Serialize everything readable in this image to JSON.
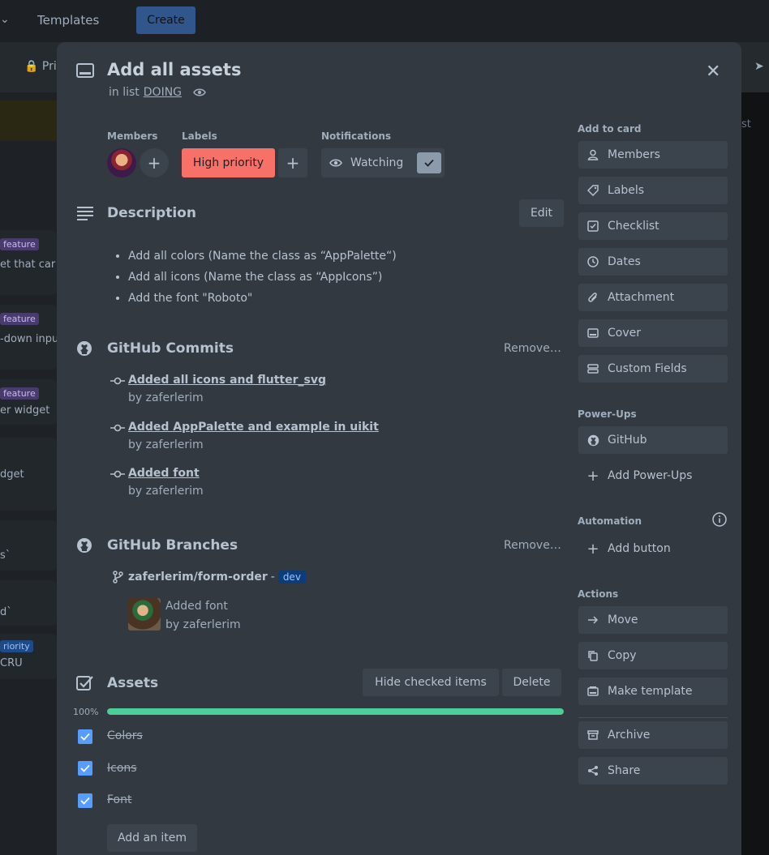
{
  "topbar": {
    "templates": "Templates",
    "create": "Create"
  },
  "boardbar": {
    "private": "Pri"
  },
  "background_cards": [
    {
      "tag": "feature",
      "text": "et that car"
    },
    {
      "tag": "feature",
      "text": "-down inpu"
    },
    {
      "tag": "feature",
      "text": "er widget"
    },
    {
      "text": "dget"
    },
    {
      "text": "s`"
    },
    {
      "text": "d`"
    },
    {
      "tag": "riority",
      "text": "CRU"
    }
  ],
  "right_peek": "st",
  "card": {
    "title": "Add all assets",
    "in_list_prefix": "in list",
    "list_name": "DOING",
    "members_label": "Members",
    "labels_label": "Labels",
    "notifications_label": "Notifications",
    "label_name": "High priority",
    "label_color": "#f87168",
    "watching": "Watching"
  },
  "description": {
    "title": "Description",
    "edit": "Edit",
    "items": [
      "Add all colors (Name the class as “AppPalette“)",
      "Add all icons (Name the class as “AppIcons”)",
      "Add the font \"Roboto\""
    ]
  },
  "commits": {
    "title": "GitHub Commits",
    "remove": "Remove…",
    "items": [
      {
        "message": "Added all icons and flutter_svg",
        "by": "by zaferlerim"
      },
      {
        "message": "Added AppPalette and example in uikit",
        "by": "by zaferlerim"
      },
      {
        "message": "Added font",
        "by": "by zaferlerim"
      }
    ]
  },
  "branches": {
    "title": "GitHub Branches",
    "remove": "Remove…",
    "branch": "zaferlerim/form-order",
    "separator": "-",
    "base": "dev",
    "last_commit": "Added font",
    "last_by": "by zaferlerim"
  },
  "checklist": {
    "title": "Assets",
    "hide_checked": "Hide checked items",
    "delete": "Delete",
    "percent_label": "100%",
    "progress": 1.0,
    "items": [
      {
        "label": "Colors",
        "checked": true
      },
      {
        "label": "Icons",
        "checked": true
      },
      {
        "label": "Font",
        "checked": true
      }
    ],
    "add_item": "Add an item"
  },
  "sidebar": {
    "add_to_card": "Add to card",
    "add_items": [
      {
        "label": "Members",
        "icon": "person-icon"
      },
      {
        "label": "Labels",
        "icon": "tag-icon"
      },
      {
        "label": "Checklist",
        "icon": "checklist-icon"
      },
      {
        "label": "Dates",
        "icon": "clock-icon"
      },
      {
        "label": "Attachment",
        "icon": "paperclip-icon"
      },
      {
        "label": "Cover",
        "icon": "cover-icon"
      },
      {
        "label": "Custom Fields",
        "icon": "custom-fields-icon"
      }
    ],
    "powerups_title": "Power-Ups",
    "github": "GitHub",
    "add_powerups": "Add Power-Ups",
    "automation_title": "Automation",
    "add_button": "Add button",
    "actions_title": "Actions",
    "actions": [
      {
        "label": "Move",
        "icon": "arrow-right-icon"
      },
      {
        "label": "Copy",
        "icon": "copy-icon"
      },
      {
        "label": "Make template",
        "icon": "template-icon"
      }
    ],
    "archive": "Archive",
    "share": "Share"
  },
  "colors": {
    "accent": "#579dff",
    "progress": "#4bce97",
    "modal_bg": "#323940"
  }
}
